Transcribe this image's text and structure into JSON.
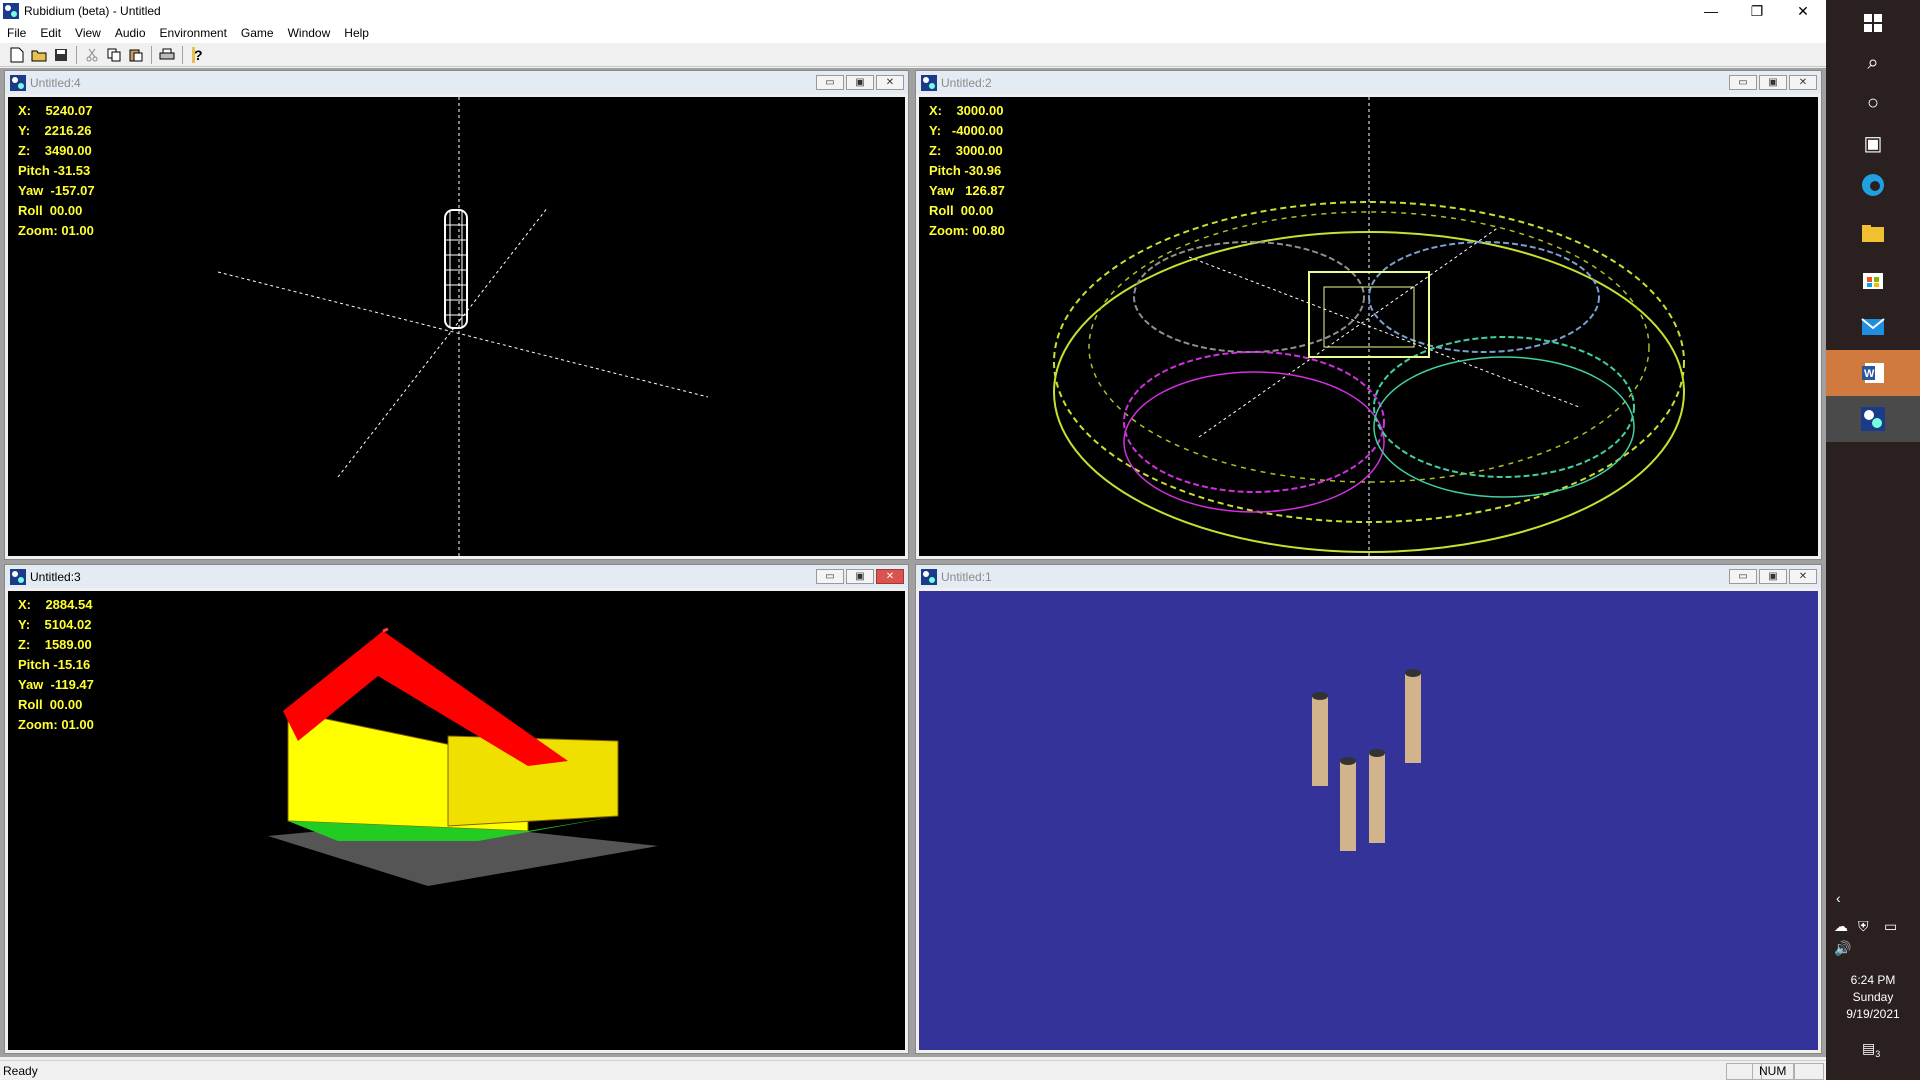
{
  "app": {
    "title": "Rubidium (beta) - Untitled",
    "caption_buttons": {
      "minimize": "—",
      "restore": "❐",
      "close": "✕"
    }
  },
  "menu": [
    "File",
    "Edit",
    "View",
    "Audio",
    "Environment",
    "Game",
    "Window",
    "Help"
  ],
  "toolbar": {
    "icons": [
      "new-icon",
      "open-icon",
      "save-icon",
      "cut-icon",
      "copy-icon",
      "paste-icon",
      "print-icon",
      "help-icon"
    ]
  },
  "windows": [
    {
      "title": "Untitled:4",
      "hud": {
        "x": "X:    5240.07",
        "y": "Y:    2216.26",
        "z": "Z:    3490.00",
        "pitch": "Pitch -31.53",
        "yaw": "Yaw  -157.07",
        "roll": "Roll  00.00",
        "zoom": "Zoom: 01.00"
      }
    },
    {
      "title": "Untitled:2",
      "hud": {
        "x": "X:    3000.00",
        "y": "Y:   -4000.00",
        "z": "Z:    3000.00",
        "pitch": "Pitch -30.96",
        "yaw": "Yaw   126.87",
        "roll": "Roll  00.00",
        "zoom": "Zoom: 00.80"
      }
    },
    {
      "title": "Untitled:3",
      "hud": {
        "x": "X:    2884.54",
        "y": "Y:    5104.02",
        "z": "Z:    1589.00",
        "pitch": "Pitch -15.16",
        "yaw": "Yaw  -119.47",
        "roll": "Roll  00.00",
        "zoom": "Zoom: 01.00"
      }
    },
    {
      "title": "Untitled:1",
      "hud": null
    }
  ],
  "child_buttons": {
    "minimize": "▭",
    "maximize": "▣",
    "close": "✕"
  },
  "status": {
    "text": "Ready",
    "num": "NUM"
  },
  "taskbar": {
    "time": "6:24 PM",
    "day": "Sunday",
    "date": "9/19/2021",
    "notifications": "3"
  },
  "colors": {
    "background_view4": "#000000",
    "background_view1": "#333399",
    "hud_text": "#ffff33",
    "roof": "#ff0000",
    "walls": "#ffff00"
  }
}
